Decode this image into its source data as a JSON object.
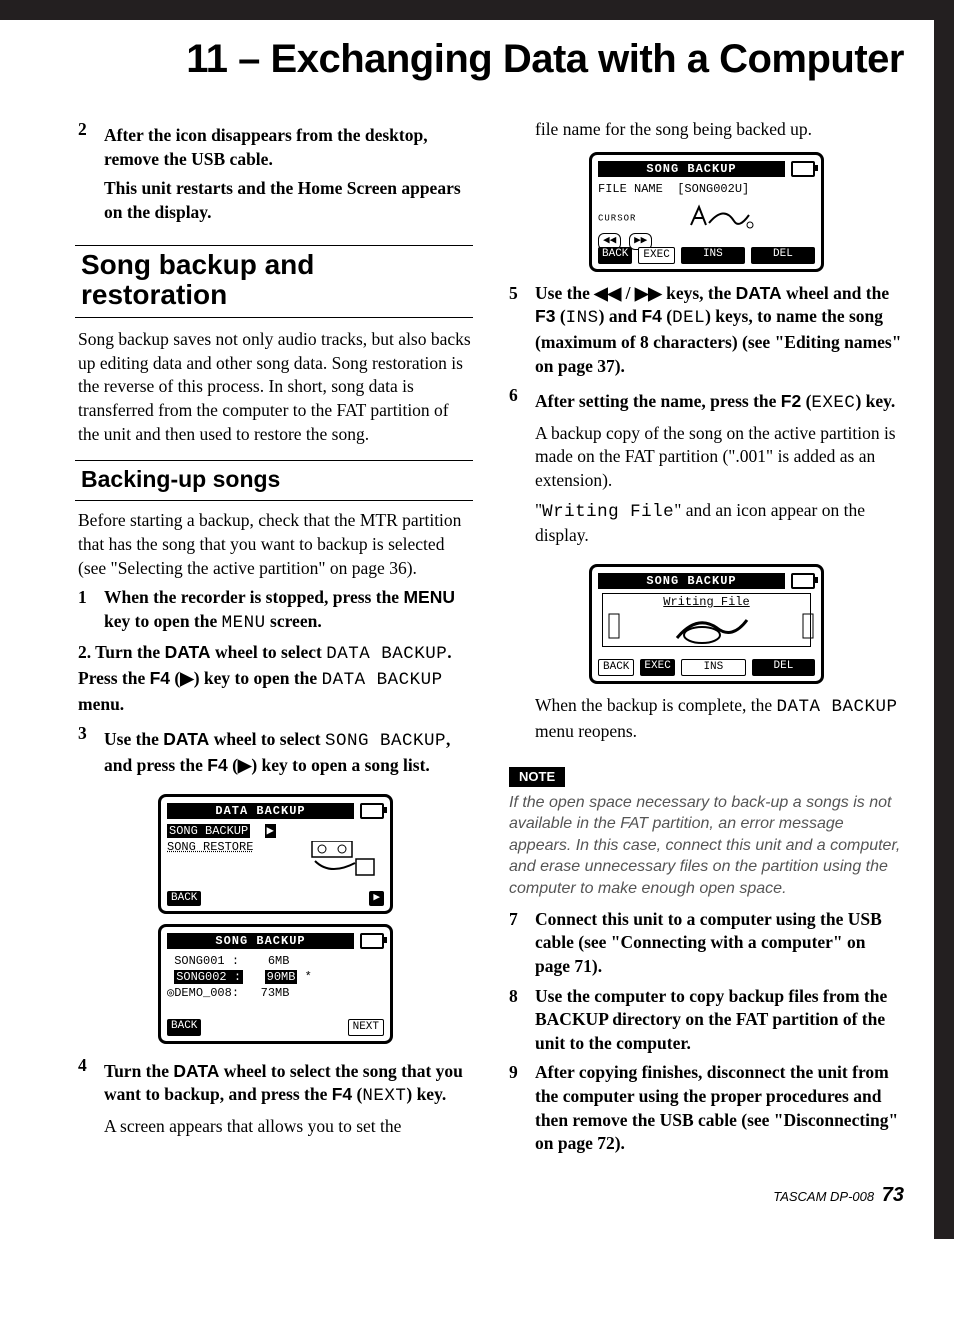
{
  "chapter_title": "11 – Exchanging Data with a Computer",
  "left": {
    "step2_line1": "After the icon disappears from the desktop, remove the USB cable.",
    "step2_line2": "This unit restarts and the Home Screen appears on the display.",
    "h2": "Song backup and restoration",
    "para1": "Song backup saves not only audio tracks, but also backs up editing data and other song data. Song restoration is the reverse of this process. In short, song data is transferred from the computer to the FAT partition of the unit and then used to restore the song.",
    "h3": "Backing-up songs",
    "para2": "Before starting a backup, check that the MTR partition that has the song that you want to backup is selected (see \"Selecting the active partition\" on page 36).",
    "s1_a": "When the recorder is stopped, press the ",
    "s1_b": "MENU",
    "s1_c": " key to open the ",
    "s1_d": "MENU",
    "s1_e": " screen.",
    "s2_a": "2. Turn the ",
    "s2_b": "DATA",
    "s2_c": " wheel to select ",
    "s2_d": "DATA BACKUP",
    "s2_e": ". Press the ",
    "s2_f": "F4",
    "s2_g": " (▶) key to open the ",
    "s2_h": "DATA BACKUP",
    "s2_i": " menu.",
    "s3_a": "Use the ",
    "s3_b": "DATA",
    "s3_c": " wheel to select ",
    "s3_d": "SONG BACKUP",
    "s3_e": ", and press the ",
    "s3_f": "F4",
    "s3_g": " (▶) key to open a song list.",
    "lcd1": {
      "title": "DATA BACKUP",
      "l1a": "SONG BACKUP",
      "l1b": "▶",
      "l2": "SONG RESTORE",
      "back": "BACK",
      "next": "▶"
    },
    "lcd2": {
      "title": "SONG BACKUP",
      "r1a": "SONG001 :",
      "r1b": "6MB",
      "r2a": "SONG002 :",
      "r2b": "90MB",
      "r2c": "*",
      "r3a": "◎DEMO_008:",
      "r3b": "73MB",
      "back": "BACK",
      "next": "NEXT"
    },
    "s4_a": "Turn the ",
    "s4_b": "DATA",
    "s4_c": " wheel to select the song that you want to backup, and press the ",
    "s4_d": "F4",
    "s4_e": " (",
    "s4_f": "NEXT",
    "s4_g": ") key.",
    "s4_cont": "A screen appears that allows you to set the"
  },
  "right": {
    "cont": "file name for the song being backed up.",
    "lcd3": {
      "title": "SONG BACKUP",
      "filelabel": "FILE NAME",
      "filename": "[SONG002U]",
      "cursor": "CURSOR",
      "back": "BACK",
      "exec": "EXEC",
      "ins": "INS",
      "del": "DEL"
    },
    "s5_a": "Use the ",
    "s5_b": "◀◀ / ▶▶",
    "s5_c": " keys, the ",
    "s5_d": "DATA",
    "s5_e": " wheel and the ",
    "s5_f": "F3",
    "s5_g": " (",
    "s5_h": "INS",
    "s5_i": ") and ",
    "s5_j": "F4",
    "s5_k": " (",
    "s5_l": "DEL",
    "s5_m": ") keys, to name the song (maximum of 8 characters) (see \"Editing names\" on page 37).",
    "s6_a": "After setting the name, press the ",
    "s6_b": "F2",
    "s6_c": " (",
    "s6_d": "EXEC",
    "s6_e": ") key.",
    "s6_p1": "A backup copy of the song on the active partition is made on the FAT partition (\".001\" is added as an extension).",
    "s6_p2a": "\"",
    "s6_p2b": "Writing File",
    "s6_p2c": "\" and an icon appear on the display.",
    "lcd4": {
      "title": "SONG BACKUP",
      "writing": "Writing File",
      "back": "BACK",
      "exec": "EXEC",
      "ins": "INS",
      "del": "DEL"
    },
    "s6_p3a": "When the backup is complete, the ",
    "s6_p3b": "DATA BACKUP",
    "s6_p3c": " menu reopens.",
    "note_label": "NOTE",
    "note": "If the open space necessary to back-up a songs is not available in the FAT partition, an error message appears. In this case, connect this unit and a computer, and erase unnecessary files on the partition using the computer to make enough open space.",
    "s7": "Connect this unit to a computer using the USB cable (see \"Connecting with a computer\" on page 71).",
    "s8": "Use the computer to copy backup files from the BACKUP directory on the FAT partition of the unit to the computer.",
    "s9": "After copying finishes, disconnect the unit from the computer using the proper procedures and then remove the USB cable (see \"Disconnecting\" on page 72).",
    "footer_model": "TASCAM  DP-008",
    "footer_page": "73"
  }
}
